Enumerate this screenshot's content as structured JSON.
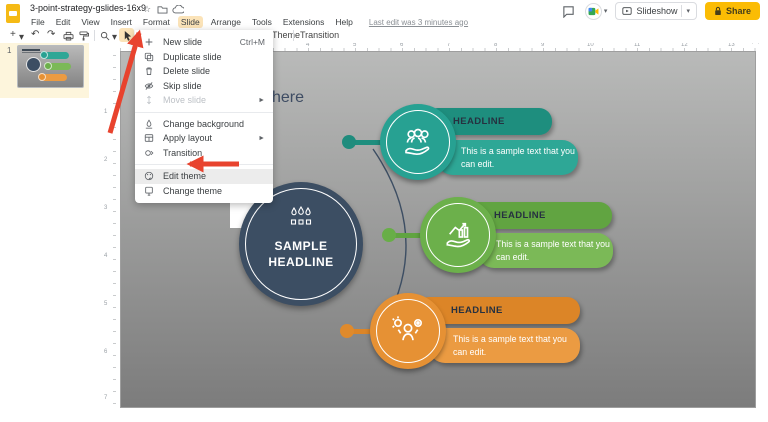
{
  "titlebar": {
    "doc_title": "3-point-strategy-gslides-16x9",
    "menu_items": [
      "File",
      "Edit",
      "View",
      "Insert",
      "Format",
      "Slide",
      "Arrange",
      "Tools",
      "Extensions",
      "Help"
    ],
    "last_edit": "Last edit was 3 minutes ago",
    "slideshow_label": "Slideshow",
    "share_label": "Share"
  },
  "toolbar": {
    "theme_label": "Theme",
    "transition_label": "Transition"
  },
  "slide_menu": {
    "items": [
      {
        "label": "New slide",
        "shortcut": "Ctrl+M",
        "icon": "plus-icon"
      },
      {
        "label": "Duplicate slide",
        "icon": "duplicate-icon"
      },
      {
        "label": "Delete slide",
        "icon": "trash-icon"
      },
      {
        "label": "Skip slide",
        "icon": "eye-off-icon"
      },
      {
        "label": "Move slide",
        "icon": "move-icon",
        "disabled": true,
        "submenu": true
      },
      {
        "label": "Change background",
        "icon": "background-icon"
      },
      {
        "label": "Apply layout",
        "icon": "layout-icon",
        "submenu": true
      },
      {
        "label": "Transition",
        "icon": "transition-icon"
      },
      {
        "label": "Edit theme",
        "icon": "palette-icon",
        "highlighted": true
      },
      {
        "label": "Change theme",
        "icon": "change-theme-icon"
      }
    ]
  },
  "ruler": {
    "horizontal": [
      "4",
      "5",
      "6",
      "7",
      "8",
      "9",
      "10",
      "11",
      "12",
      "13"
    ],
    "vertical": [
      "1",
      "2",
      "3",
      "4",
      "5",
      "6",
      "7"
    ]
  },
  "filmstrip": {
    "slide_number": "1"
  },
  "slide": {
    "title_visible_fragment": "here",
    "center_circle": {
      "line1": "SAMPLE",
      "line2": "HEADLINE"
    },
    "items": [
      {
        "headline": "HEADLINE",
        "body": "This is a sample text that you can edit.",
        "circle_color": "#27a192",
        "banner_color": "#1e8e7e",
        "body_color": "#2ea796",
        "dot_color": "#1f8c7d",
        "icon": "team-in-hand-icon"
      },
      {
        "headline": "HEADLINE",
        "body": "This is a sample text that you can edit.",
        "circle_color": "#6cb04b",
        "banner_color": "#61a441",
        "body_color": "#7bb957",
        "dot_color": "#68ae47",
        "icon": "growth-in-hand-icon"
      },
      {
        "headline": "HEADLINE",
        "body": "This is a sample text that you can edit.",
        "circle_color": "#e69134",
        "banner_color": "#dc8527",
        "body_color": "#eb9b42",
        "dot_color": "#df8a2c",
        "icon": "idea-person-icon"
      }
    ]
  },
  "colors": {
    "arrow_annotation": "#e8432e",
    "share_button": "#fbbc04",
    "menu_highlight": "#fbe3b8",
    "navy": "#3c4e63",
    "slide_bg_top": "#b9bab9",
    "slide_bg_bottom": "#7c7c7c"
  }
}
